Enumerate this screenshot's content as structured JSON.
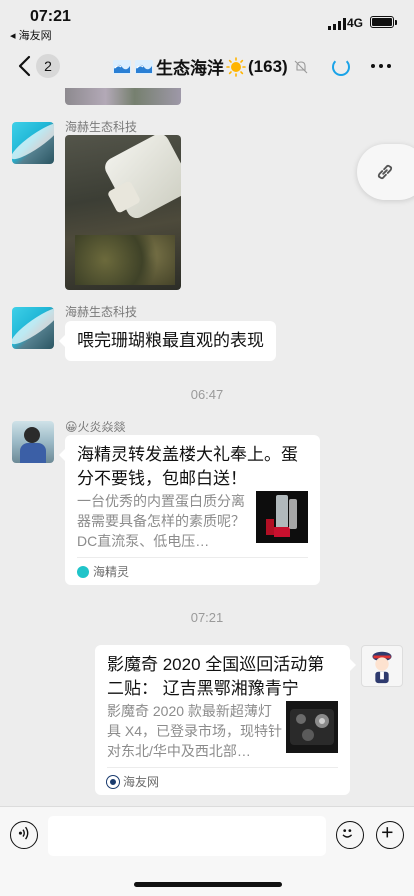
{
  "status_bar": {
    "time": "07:21",
    "back_app": "◂ 海友网",
    "network": "4G"
  },
  "nav": {
    "unread_count": "2",
    "title": "生态海洋",
    "member_count": "(163)"
  },
  "messages": {
    "m1": {
      "sender": "海赫生态科技"
    },
    "m2": {
      "sender": "海赫生态科技",
      "text": "喂完珊瑚粮最直观的表现"
    },
    "t1": "06:47",
    "m3": {
      "sender": "😀火炎焱燚",
      "card_title": "海精灵转发盖楼大礼奉上。蛋分不要钱，包邮白送！",
      "card_desc": "一台优秀的内置蛋白质分离器需要具备怎样的素质呢？DC直流泵、低电压…",
      "card_source": "海精灵"
    },
    "t2": "07:21",
    "m4": {
      "card_title": "影魔奇 2020 全国巡回活动第二贴： 辽吉黑鄂湘豫青宁",
      "card_desc": "影魔奇 2020 款最新超薄灯具 X4，已登录市场，现特针对东北/华中及西北部…",
      "card_source": "海友网"
    }
  },
  "input": {
    "placeholder": ""
  },
  "colors": {
    "background": "#ededed",
    "accent": "#1aa3e8"
  }
}
